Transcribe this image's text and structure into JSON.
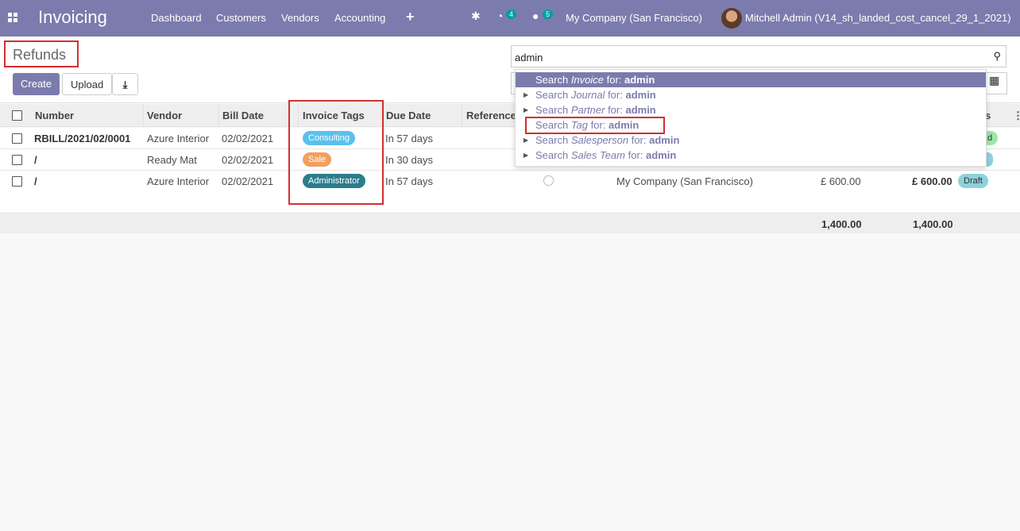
{
  "app": {
    "title": "Invoicing",
    "menu": [
      "Dashboard",
      "Customers",
      "Vendors",
      "Accounting"
    ],
    "activity_count": "4",
    "message_count": "5",
    "company": "My Company (San Francisco)",
    "user": "Mitchell Admin (V14_sh_landed_cost_cancel_29_1_2021)"
  },
  "page": {
    "title": "Refunds",
    "create_label": "Create",
    "upload_label": "Upload"
  },
  "search": {
    "value": "admin",
    "items": [
      {
        "prefix": "Search ",
        "field": "Invoice",
        "middle": " for: ",
        "term": "admin"
      },
      {
        "prefix": "Search ",
        "field": "Journal",
        "middle": " for: ",
        "term": "admin"
      },
      {
        "prefix": "Search ",
        "field": "Partner",
        "middle": " for: ",
        "term": "admin"
      },
      {
        "prefix": "Search ",
        "field": "Tag",
        "middle": " for: ",
        "term": "admin"
      },
      {
        "prefix": "Search ",
        "field": "Salesperson",
        "middle": " for: ",
        "term": "admin"
      },
      {
        "prefix": "Search ",
        "field": "Sales Team",
        "middle": " for: ",
        "term": "admin"
      }
    ]
  },
  "table": {
    "headers": {
      "number": "Number",
      "vendor": "Vendor",
      "bill_date": "Bill Date",
      "invoice_tags": "Invoice Tags",
      "due_date": "Due Date",
      "reference": "Reference",
      "status_tail": "s"
    },
    "rows": [
      {
        "number": "RBILL/2021/02/0001",
        "vendor": "Azure Interior",
        "bill_date": "02/02/2021",
        "tag": "Consulting",
        "due": "In 57 days",
        "status_fragment": "d"
      },
      {
        "number": "/",
        "vendor": "Ready Mat",
        "bill_date": "02/02/2021",
        "tag": "Sale",
        "due": "In 30 days"
      },
      {
        "number": "/",
        "vendor": "Azure Interior",
        "bill_date": "02/02/2021",
        "tag": "Administrator",
        "due": "In 57 days",
        "company": "My Company (San Francisco)",
        "untaxed": "£ 600.00",
        "total": "£ 600.00",
        "status": "Draft"
      }
    ],
    "totals": {
      "untaxed": "1,400.00",
      "total": "1,400.00"
    }
  },
  "colors": {
    "brand": "#7c7bad",
    "tag_consulting": "#5bc0eb",
    "tag_sale": "#f0a060",
    "tag_administrator": "#2c7d8c",
    "status_draft": "#8ed1dc",
    "status_posted": "#9be7a8",
    "highlight": "#d32f2f"
  }
}
